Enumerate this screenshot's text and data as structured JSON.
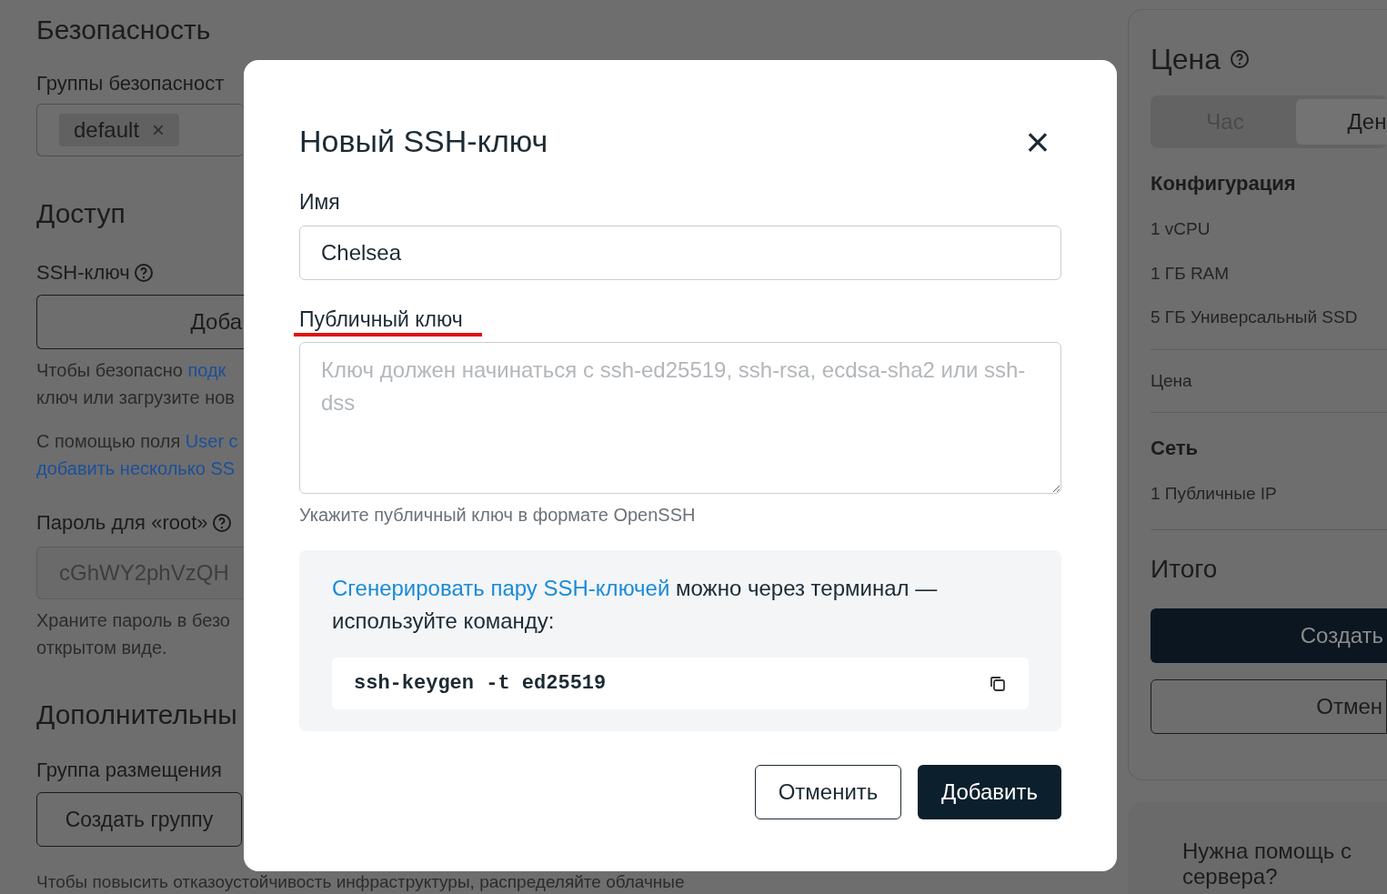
{
  "background_left": {
    "security": {
      "heading": "Безопасность",
      "groups_label": "Группы безопасност",
      "tags": [
        {
          "label": "default",
          "remove": "×"
        }
      ]
    },
    "access": {
      "heading": "Доступ",
      "ssh_label": "SSH-ключ",
      "ssh_button": "Доба",
      "ssh_hint_1": "Чтобы безопасно ",
      "ssh_hint_link": "подк",
      "ssh_hint_2": "ключ или загрузите нов",
      "userdata_hint_1": "С помощью поля ",
      "userdata_hint_link_1": "User c",
      "userdata_hint_link_2": "добавить несколько SS",
      "root_label": "Пароль для «root»",
      "root_value": "cGhWY2phVzQH",
      "root_hint": "Храните пароль в безо",
      "root_hint_2": "открытом виде."
    },
    "extra": {
      "heading": "Дополнительны",
      "placement_label": "Группа размещения",
      "create_group": "Создать группу",
      "placement_hint": "Чтобы повысить отказоустойчивость инфраструктуры, распределяйте облачные"
    }
  },
  "background_right": {
    "price_heading": "Цена",
    "period_tabs": [
      {
        "label": "Час",
        "selected": false
      },
      {
        "label": "Ден",
        "selected": true
      }
    ],
    "sections": [
      {
        "heading": "Конфигурация",
        "items": [
          "1 vCPU",
          "1 ГБ RAM",
          "5 ГБ Универсальный SSD"
        ]
      },
      {
        "items": [
          "Цена"
        ]
      },
      {
        "heading": "Сеть",
        "items": [
          "1 Публичные IP"
        ]
      }
    ],
    "total": "Итого",
    "create_button": "Создать",
    "cancel_button": "Отмен",
    "help_title": "Нужна помощь с",
    "help_title_2": "сервера?"
  },
  "modal": {
    "title": "Новый SSH-ключ",
    "close": "×",
    "name_field": {
      "label": "Имя",
      "value": "Chelsea"
    },
    "key_field": {
      "label": "Публичный ключ",
      "placeholder": "Ключ должен начинаться с ssh-ed25519, ssh-rsa, ecdsa-sha2 или ssh-dss",
      "hint": "Укажите публичный ключ в формате OpenSSH",
      "annotated": true
    },
    "info": {
      "link": "Сгенерировать пару SSH-ключей",
      "text": " можно через терминал — используйте команду:",
      "command": "ssh-keygen -t ed25519"
    },
    "buttons": [
      {
        "label": "Отменить",
        "kind": "secondary"
      },
      {
        "label": "Добавить",
        "kind": "primary"
      }
    ]
  }
}
